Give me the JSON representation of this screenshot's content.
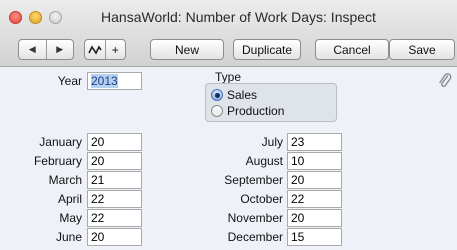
{
  "window": {
    "title": "HansaWorld: Number of Work Days: Inspect"
  },
  "toolbar": {
    "nav_prev_icon": "triangle-left-icon",
    "nav_next_icon": "triangle-right-icon",
    "graph_icon": "zigzag-graph-icon",
    "plus_label": "+",
    "new_label": "New",
    "duplicate_label": "Duplicate",
    "cancel_label": "Cancel",
    "save_label": "Save"
  },
  "form": {
    "year_label": "Year",
    "year_value": "2013",
    "type_label": "Type",
    "type_options": [
      {
        "label": "Sales",
        "selected": true
      },
      {
        "label": "Production",
        "selected": false
      }
    ],
    "attachment_icon": "paperclip-icon",
    "months_left": [
      {
        "label": "January",
        "value": "20"
      },
      {
        "label": "February",
        "value": "20"
      },
      {
        "label": "March",
        "value": "21"
      },
      {
        "label": "April",
        "value": "22"
      },
      {
        "label": "May",
        "value": "22"
      },
      {
        "label": "June",
        "value": "20"
      }
    ],
    "months_right": [
      {
        "label": "July",
        "value": "23"
      },
      {
        "label": "August",
        "value": "10"
      },
      {
        "label": "September",
        "value": "20"
      },
      {
        "label": "October",
        "value": "22"
      },
      {
        "label": "November",
        "value": "20"
      },
      {
        "label": "December",
        "value": "15"
      }
    ]
  }
}
